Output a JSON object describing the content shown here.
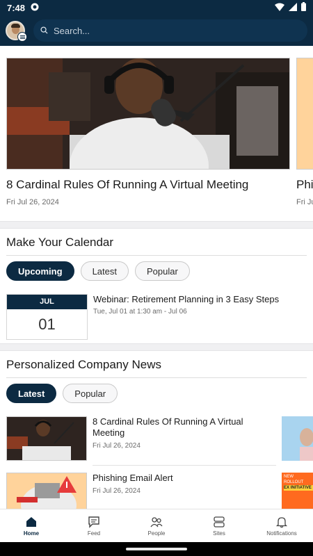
{
  "status_bar": {
    "time": "7:48"
  },
  "header": {
    "search_placeholder": "Search..."
  },
  "featured": [
    {
      "title": "8 Cardinal Rules Of Running A Virtual Meeting",
      "date": "Fri Jul 26, 2024"
    },
    {
      "title": "Phi",
      "date": "Fri Ju"
    }
  ],
  "calendar": {
    "title": "Make Your Calendar",
    "tabs": [
      {
        "label": "Upcoming",
        "active": true
      },
      {
        "label": "Latest",
        "active": false
      },
      {
        "label": "Popular",
        "active": false
      }
    ],
    "events": [
      {
        "month": "JUL",
        "day": "01",
        "title": "Webinar: Retirement Planning in 3 Easy Steps",
        "meta": "Tue, Jul 01 at 1:30 am - Jul 06"
      }
    ]
  },
  "news": {
    "title": "Personalized Company News",
    "tabs": [
      {
        "label": "Latest",
        "active": true
      },
      {
        "label": "Popular",
        "active": false
      }
    ],
    "items": [
      {
        "title": "8 Cardinal Rules Of Running A Virtual Meeting",
        "date": "Fri Jul 26, 2024"
      },
      {
        "title": "Phishing Email Alert",
        "date": "Fri Jul 26, 2024"
      }
    ],
    "peek_text": [
      "NEW",
      "ROLLOUT",
      "EX INITIATIVE"
    ]
  },
  "bottom_nav": [
    {
      "label": "Home",
      "icon": "home-icon",
      "active": true
    },
    {
      "label": "Feed",
      "icon": "feed-icon",
      "active": false
    },
    {
      "label": "People",
      "icon": "people-icon",
      "active": false
    },
    {
      "label": "Sites",
      "icon": "sites-icon",
      "active": false
    },
    {
      "label": "Notifications",
      "icon": "bell-icon",
      "active": false
    }
  ],
  "colors": {
    "brand": "#0c2a42",
    "divider": "#f0f0f2"
  }
}
